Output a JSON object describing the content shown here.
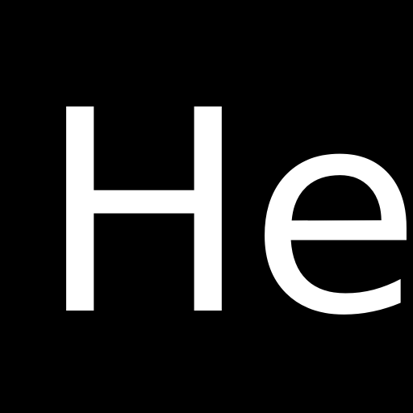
{
  "symbol": "He",
  "colors": {
    "background": "#000000",
    "text": "#ffffff"
  }
}
